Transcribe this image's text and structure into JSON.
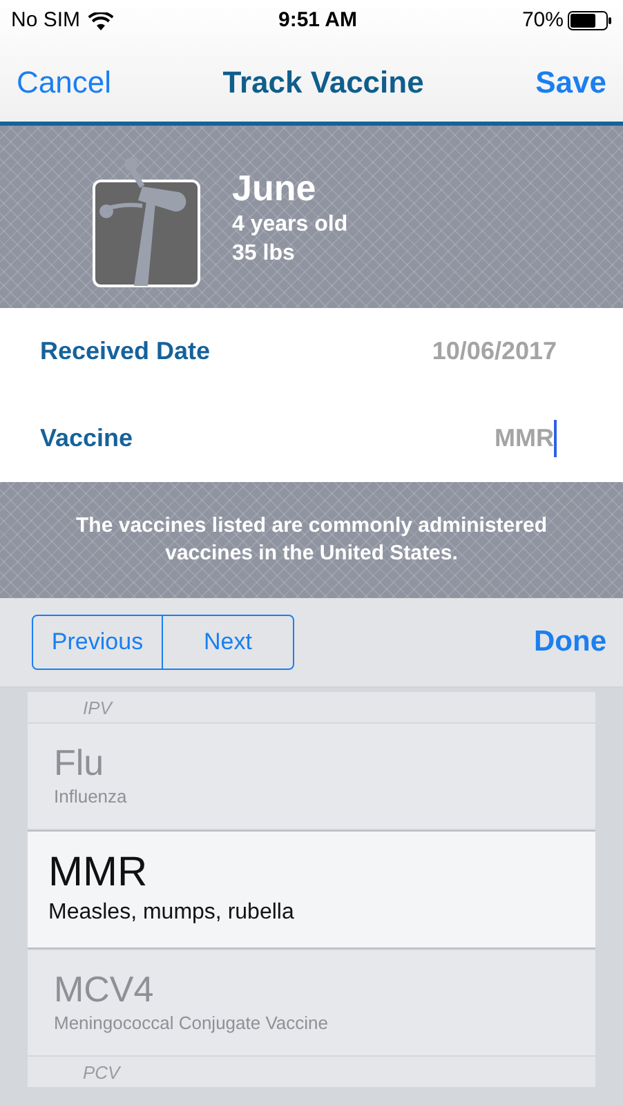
{
  "status_bar": {
    "carrier": "No SIM",
    "time": "9:51 AM",
    "battery": "70%"
  },
  "nav": {
    "cancel": "Cancel",
    "title": "Track Vaccine",
    "save": "Save"
  },
  "profile": {
    "name": "June",
    "age": "4 years old",
    "weight": "35 lbs"
  },
  "form": [
    {
      "label": "Received Date",
      "value": "10/06/2017",
      "focused": false
    },
    {
      "label": "Vaccine",
      "value": "MMR",
      "focused": true
    }
  ],
  "note": "The vaccines listed are commonly administered vaccines in the United States.",
  "toolbar": {
    "previous": "Previous",
    "next": "Next",
    "done": "Done"
  },
  "picker": [
    {
      "name": "IPV",
      "selected": false,
      "kind": "edge"
    },
    {
      "name": "Flu",
      "description": "Influenza",
      "selected": false,
      "kind": "near"
    },
    {
      "name": "MMR",
      "description": "Measles, mumps, rubella",
      "selected": true,
      "kind": "near"
    },
    {
      "name": "MCV4",
      "description": "Meningococcal Conjugate Vaccine",
      "selected": false,
      "kind": "near"
    },
    {
      "name": "PCV",
      "selected": false,
      "kind": "edge"
    }
  ]
}
